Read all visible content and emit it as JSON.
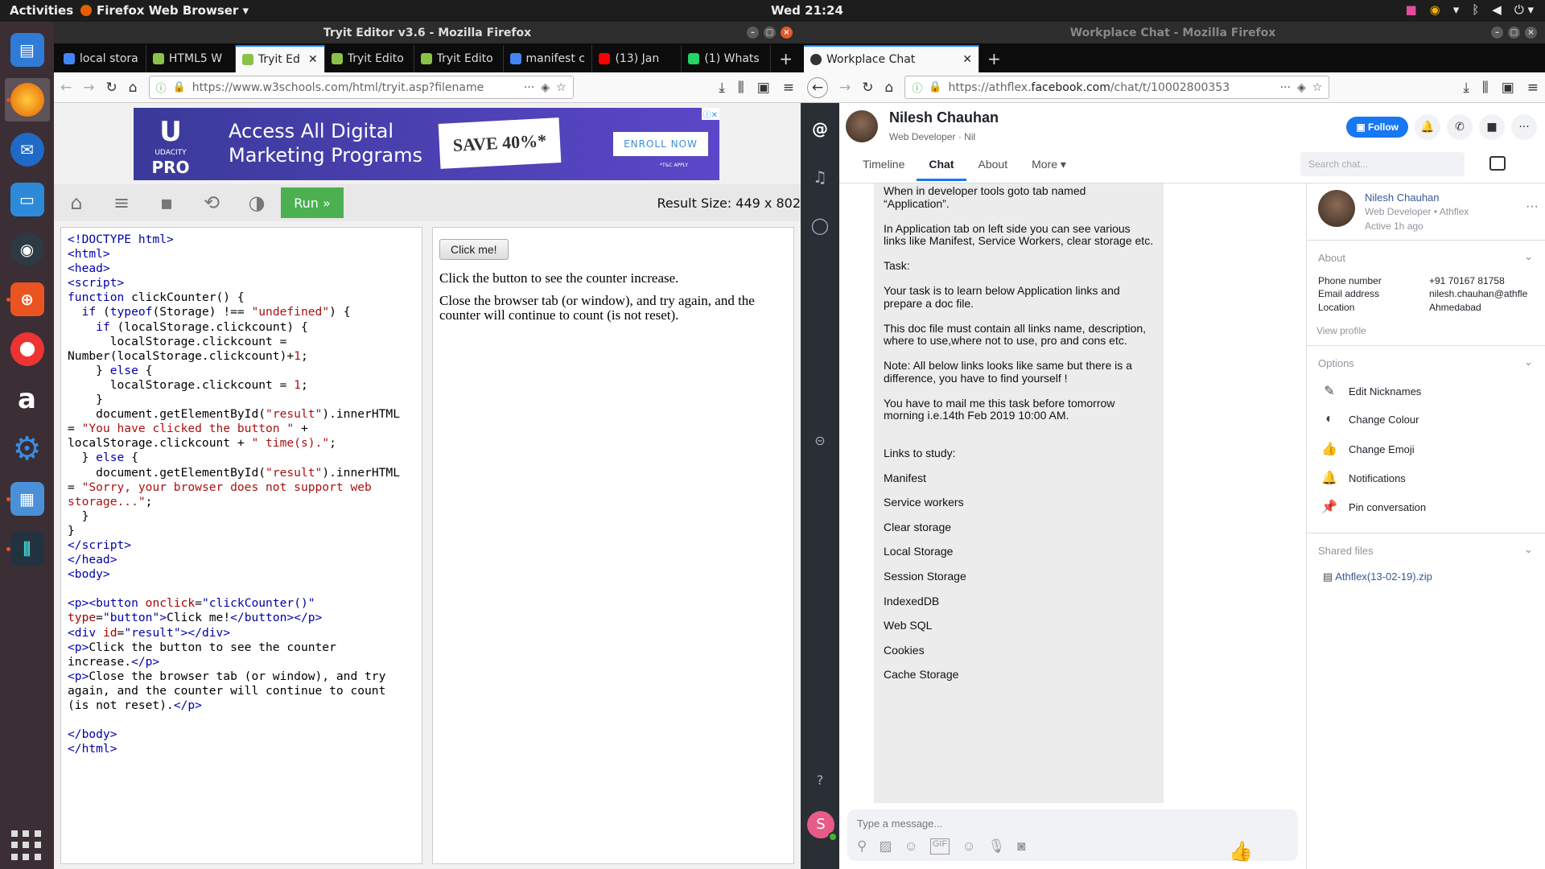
{
  "topbar": {
    "activities": "Activities",
    "app": "Firefox Web Browser ▾",
    "clock": "Wed 21:24"
  },
  "left_window": {
    "title": "Tryit Editor v3.6 - Mozilla Firefox",
    "tabs": [
      {
        "label": "local stora",
        "color": "#4285f4"
      },
      {
        "label": "HTML5 W",
        "color": "#8ac249"
      },
      {
        "label": "Tryit Ed",
        "color": "#8ac249",
        "active": true
      },
      {
        "label": "Tryit Edito",
        "color": "#8ac249"
      },
      {
        "label": "Tryit Edito",
        "color": "#8ac249"
      },
      {
        "label": "manifest c",
        "color": "#4285f4"
      },
      {
        "label": "(13) Jan",
        "color": "#ff0000"
      },
      {
        "label": "(1) Whats",
        "color": "#25d366"
      }
    ],
    "url": "https://www.w3schools.com/html/tryit.asp?filename",
    "ad": {
      "brand": "UDACITY",
      "brand2": "PRO",
      "line1": "Access All Digital",
      "line2": "Marketing Programs",
      "save": "SAVE 40%*",
      "cta": "ENROLL NOW",
      "tc": "*T&C APPLY"
    },
    "run_label": "Run »",
    "result_size": "Result Size: 449 x 802",
    "result": {
      "button": "Click me!",
      "p1": "Click the button to see the counter increase.",
      "p2": "Close the browser tab (or window), and try again, and the counter will continue to count (is not reset)."
    }
  },
  "right_window": {
    "title": "Workplace Chat - Mozilla Firefox",
    "tab_label": "Workplace Chat",
    "url_prefix": "https://athflex.",
    "url_domain": "facebook.com",
    "url_suffix": "/chat/t/10002800353",
    "profile": {
      "name": "Nilesh Chauhan",
      "subtitle": "Web Developer · Nil"
    },
    "follow_label": "Follow",
    "tabs": [
      "Timeline",
      "Chat",
      "About",
      "More ▾"
    ],
    "search_placeholder": "Search chat...",
    "message_lines": [
      "When in developer tools goto tab named",
      "“Application”.",
      "",
      "In Application tab on left side you can see various",
      "links like Manifest, Service Workers, clear storage etc.",
      "",
      "Task:",
      "",
      "Your task is to learn below Application links and",
      "prepare a doc file.",
      "",
      "This doc file must contain all links name, description,",
      "where to use,where not to use,  pro and cons etc.",
      "",
      "Note: All below links looks like same but there is a",
      "difference, you have to find yourself !",
      "",
      "You have to mail me this task before tomorrow",
      "morning i.e.14th Feb 2019 10:00 AM."
    ],
    "links_title": "Links to study:",
    "links": [
      "Manifest",
      "Service workers",
      "Clear storage",
      "Local Storage",
      "Session Storage",
      "IndexedDB",
      "Web SQL",
      "Cookies",
      "Cache Storage"
    ],
    "composer_placeholder": "Type a message...",
    "avatar_letter": "S",
    "sidebar": {
      "name": "Nilesh Chauhan",
      "sub": "Web Developer • Athflex",
      "active": "Active 1h ago",
      "about_title": "About",
      "fields": [
        {
          "k": "Phone number",
          "v": "+91 70167 81758"
        },
        {
          "k": "Email address",
          "v": "nilesh.chauhan@athfle"
        },
        {
          "k": "Location",
          "v": "Ahmedabad"
        }
      ],
      "view_profile": "View profile",
      "options_title": "Options",
      "options": [
        {
          "label": "Edit Nicknames",
          "icon": "✎"
        },
        {
          "label": "Change Colour",
          "icon": "◐"
        },
        {
          "label": "Change Emoji",
          "icon": "👍"
        },
        {
          "label": "Notifications",
          "icon": "🔔"
        },
        {
          "label": "Pin conversation",
          "icon": "📌"
        }
      ],
      "shared_title": "Shared files",
      "file": "Athflex(13-02-19).zip"
    }
  }
}
